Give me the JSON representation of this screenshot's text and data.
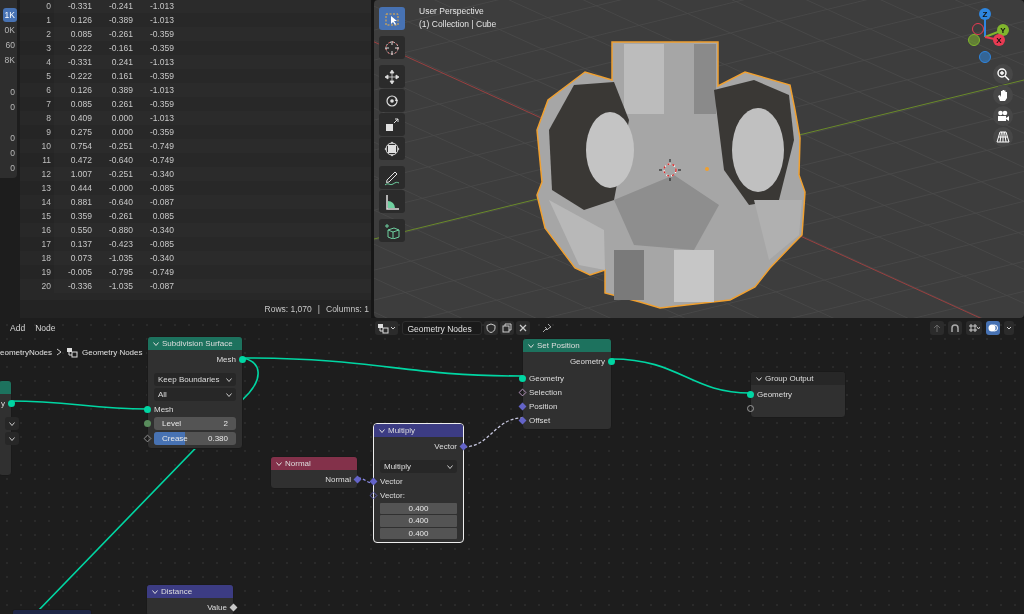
{
  "spreadsheet": {
    "sidebar_counts": [
      {
        "text": "1K",
        "selected": true
      },
      {
        "text": "0K",
        "selected": false
      },
      {
        "text": "60",
        "selected": false
      },
      {
        "text": "8K",
        "selected": false
      },
      {
        "text": "0",
        "selected": false
      },
      {
        "text": "0",
        "selected": false
      },
      {
        "text": "0",
        "selected": false
      },
      {
        "text": "0",
        "selected": false
      },
      {
        "text": "0",
        "selected": false
      }
    ],
    "rows": [
      {
        "index": "0",
        "values": [
          "-0.331",
          "-0.241",
          "-1.013"
        ]
      },
      {
        "index": "1",
        "values": [
          "0.126",
          "-0.389",
          "-1.013"
        ]
      },
      {
        "index": "2",
        "values": [
          "0.085",
          "-0.261",
          "-0.359"
        ]
      },
      {
        "index": "3",
        "values": [
          "-0.222",
          "-0.161",
          "-0.359"
        ]
      },
      {
        "index": "4",
        "values": [
          "-0.331",
          "0.241",
          "-1.013"
        ]
      },
      {
        "index": "5",
        "values": [
          "-0.222",
          "0.161",
          "-0.359"
        ]
      },
      {
        "index": "6",
        "values": [
          "0.126",
          "0.389",
          "-1.013"
        ]
      },
      {
        "index": "7",
        "values": [
          "0.085",
          "0.261",
          "-0.359"
        ]
      },
      {
        "index": "8",
        "values": [
          "0.409",
          "0.000",
          "-1.013"
        ]
      },
      {
        "index": "9",
        "values": [
          "0.275",
          "0.000",
          "-0.359"
        ]
      },
      {
        "index": "10",
        "values": [
          "0.754",
          "-0.251",
          "-0.749"
        ]
      },
      {
        "index": "11",
        "values": [
          "0.472",
          "-0.640",
          "-0.749"
        ]
      },
      {
        "index": "12",
        "values": [
          "1.007",
          "-0.251",
          "-0.340"
        ]
      },
      {
        "index": "13",
        "values": [
          "0.444",
          "-0.000",
          "-0.085"
        ]
      },
      {
        "index": "14",
        "values": [
          "0.881",
          "-0.640",
          "-0.087"
        ]
      },
      {
        "index": "15",
        "values": [
          "0.359",
          "-0.261",
          "0.085"
        ]
      },
      {
        "index": "16",
        "values": [
          "0.550",
          "-0.880",
          "-0.340"
        ]
      },
      {
        "index": "17",
        "values": [
          "0.137",
          "-0.423",
          "-0.085"
        ]
      },
      {
        "index": "18",
        "values": [
          "0.073",
          "-1.035",
          "-0.340"
        ]
      },
      {
        "index": "19",
        "values": [
          "-0.005",
          "-0.795",
          "-0.749"
        ]
      },
      {
        "index": "20",
        "values": [
          "-0.336",
          "-1.035",
          "-0.087"
        ]
      }
    ],
    "footer": {
      "rows": "Rows: 1,070",
      "separator": "|",
      "columns": "Columns: 1"
    }
  },
  "viewport": {
    "view_name": "User Perspective",
    "context": "(1) Collection | Cube",
    "tools": [
      {
        "kind": "select-box",
        "selected": true
      },
      {
        "kind": "cursor",
        "selected": false
      },
      {
        "kind": "move",
        "selected": false
      },
      {
        "kind": "rotate",
        "selected": false
      },
      {
        "kind": "scale",
        "selected": false
      },
      {
        "kind": "transform",
        "selected": false
      },
      {
        "kind": "annotate",
        "selected": false
      },
      {
        "kind": "measure",
        "selected": false
      },
      {
        "kind": "add-cube",
        "selected": false
      }
    ],
    "gizmo_axes": [
      {
        "label": "Z",
        "color": "#2e86e0"
      },
      {
        "label": "Y",
        "color": "#80b52d"
      },
      {
        "label": "X",
        "color": "#e83a52"
      }
    ]
  },
  "node_editor": {
    "menus": [
      "Add",
      "Node"
    ],
    "node_group": {
      "value": "Geometry Nodes"
    },
    "breadcrumb": [
      "eometryNodes",
      "Geometry Nodes"
    ],
    "nodes": [
      {
        "kind": "geometry",
        "selected": false,
        "rows": [
          {
            "kind": "output",
            "label": "y",
            "socket": {
              "kind": "geometry"
            }
          },
          {
            "kind": "dropdown"
          },
          {
            "kind": "dropdown"
          }
        ]
      },
      {
        "title": "Subdivision Surface",
        "kind": "geometry",
        "selected": false,
        "rows": [
          {
            "kind": "output",
            "label": "Mesh",
            "socket": {
              "kind": "geometry"
            }
          },
          {
            "kind": "dropdown",
            "value": "Keep Boundaries"
          },
          {
            "kind": "dropdown",
            "value": "All"
          },
          {
            "kind": "input",
            "label": "Mesh",
            "socket": {
              "kind": "geometry"
            }
          },
          {
            "kind": "field",
            "label": "Level",
            "value": "2",
            "socket": {
              "kind": "int"
            }
          },
          {
            "kind": "slider",
            "label": "Crease",
            "value": "0.380",
            "level": 0.38,
            "socket": {
              "kind": "float-field"
            }
          }
        ]
      },
      {
        "title": "Set Position",
        "kind": "geometry",
        "selected": false,
        "rows": [
          {
            "kind": "output",
            "label": "Geometry",
            "socket": {
              "kind": "geometry"
            }
          },
          {
            "kind": "input",
            "label": "Geometry",
            "socket": {
              "kind": "geometry"
            }
          },
          {
            "kind": "input",
            "label": "Selection",
            "socket": {
              "kind": "bool-field"
            }
          },
          {
            "kind": "input",
            "label": "Position",
            "socket": {
              "kind": "vector"
            }
          },
          {
            "kind": "input",
            "label": "Offset",
            "socket": {
              "kind": "vector"
            }
          }
        ]
      },
      {
        "title": "Group Output",
        "kind": "output",
        "selected": false,
        "rows": [
          {
            "kind": "input",
            "label": "Geometry",
            "socket": {
              "kind": "geometry"
            }
          },
          {
            "kind": "input",
            "socket": {
              "kind": "empty"
            }
          }
        ]
      },
      {
        "title": "Multiply",
        "kind": "vector",
        "selected": true,
        "rows": [
          {
            "kind": "output",
            "label": "Vector",
            "socket": {
              "kind": "vector"
            }
          },
          {
            "kind": "dropdown",
            "value": "Multiply"
          },
          {
            "kind": "input",
            "label": "Vector",
            "socket": {
              "kind": "vector"
            }
          },
          {
            "kind": "input",
            "label": "Vector:",
            "socket": {
              "kind": "vector-field"
            }
          },
          {
            "kind": "value",
            "value": "0.400"
          },
          {
            "kind": "value",
            "value": "0.400"
          },
          {
            "kind": "value",
            "value": "0.400"
          }
        ]
      },
      {
        "title": "Normal",
        "kind": "input",
        "selected": false,
        "rows": [
          {
            "kind": "output",
            "label": "Normal",
            "socket": {
              "kind": "vector"
            }
          }
        ]
      },
      {
        "title": "Distance",
        "kind": "vector",
        "selected": false,
        "rows": [
          {
            "kind": "output",
            "label": "Value",
            "socket": {
              "kind": "float"
            }
          }
        ]
      },
      {
        "kind": "attribute",
        "selected": false
      }
    ]
  }
}
